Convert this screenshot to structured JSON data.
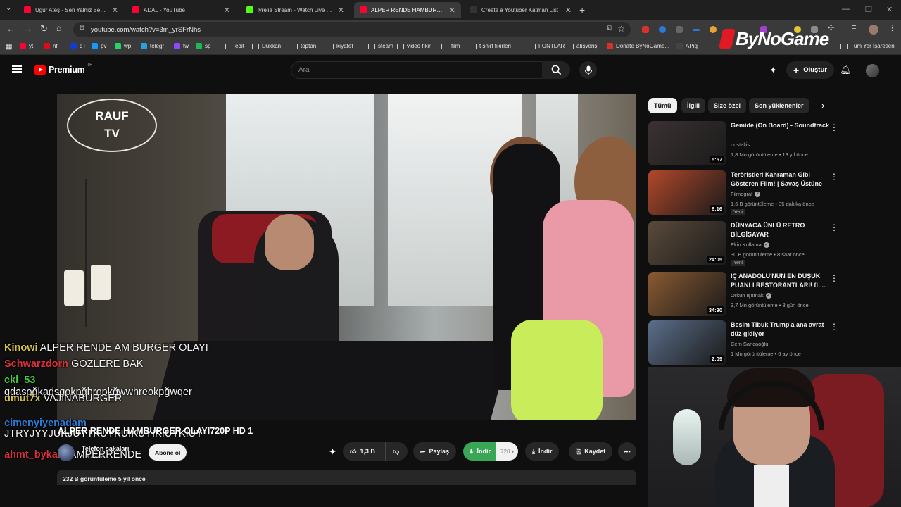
{
  "browser": {
    "tabs": [
      {
        "title": "Uğur Ateş - Sen Yalnız Ben Yalnız",
        "fav": "#ff0033",
        "active": false
      },
      {
        "title": "ADAL - YouTube",
        "fav": "#ff0033",
        "active": false
      },
      {
        "title": "lyrelia Stream - Watch Live on Kick",
        "fav": "#53fc18",
        "active": false
      },
      {
        "title": "ALPER RENDE HAMBURGER OLAYI",
        "fav": "#ff0033",
        "active": true
      },
      {
        "title": "Create a Youtuber Katman List",
        "fav": "#333333",
        "active": false
      }
    ],
    "url": "youtube.com/watch?v=3m_yrSFrNhs",
    "bookmarks": [
      {
        "label": "yt",
        "icon": "#ff0033"
      },
      {
        "label": "nf",
        "icon": "#e50914"
      },
      {
        "label": "d+",
        "icon": "#113ccf"
      },
      {
        "label": "pv",
        "icon": "#1399ff"
      },
      {
        "label": "wp",
        "icon": "#25d366"
      },
      {
        "label": "telegr",
        "icon": "#2aa1da"
      },
      {
        "label": "tw",
        "icon": "#9146ff"
      },
      {
        "label": "sp",
        "icon": "#1db954"
      },
      {
        "label": "edit",
        "icon": "folder"
      },
      {
        "label": "Dükkan",
        "icon": "folder"
      },
      {
        "label": "toptan",
        "icon": "folder"
      },
      {
        "label": "kıyafet",
        "icon": "folder"
      },
      {
        "label": "steam",
        "icon": "folder"
      },
      {
        "label": "video fikir",
        "icon": "folder"
      },
      {
        "label": "film",
        "icon": "folder"
      },
      {
        "label": "t shirt fikirleri",
        "icon": "folder"
      },
      {
        "label": "FONTLAR",
        "icon": "folder"
      },
      {
        "label": "alışveriş",
        "icon": "folder"
      },
      {
        "label": "Donate ByNoGame...",
        "icon": "#d9302c"
      },
      {
        "label": "APiq",
        "icon": "#444444"
      }
    ],
    "all_bookmarks": "Tüm Yer İşaretleri",
    "overlay_logo": "ByNoGame"
  },
  "youtube": {
    "logo_text": "Premium",
    "logo_region": "TR",
    "search_placeholder": "Ara",
    "create_label": "Oluştur"
  },
  "video": {
    "watermark_line1": "RAUF",
    "watermark_line2": "TV",
    "title": "ALPER RENDE HAMBURGER OLAYI720P HD 1",
    "channel": "Telefon sakaları",
    "subs": "3 B abone",
    "subscribe": "Abone ol",
    "likes": "1,3 B",
    "share": "Paylaş",
    "download_ext": "İndir",
    "quality": "720",
    "download": "İndir",
    "save": "Kaydet",
    "views_date": "232 B görüntüleme  5 yıl önce"
  },
  "chat": [
    {
      "user": "Kinowi",
      "color": "#d8c34a",
      "text": "ALPER RENDE AM BURGER OLAYI"
    },
    {
      "user": "Schwarzdorn",
      "color": "#d9313b",
      "text": "GÖZLERE BAK"
    },
    {
      "user": "ckl_53",
      "color": "#3fcf3f",
      "text": "gdasoğkadsgokpğhropkğwwhreokpğwqer"
    },
    {
      "user": "umut7x",
      "color": "#d8c34a",
      "text": "VAJINABURGER"
    },
    {
      "user": "cimenyiyenadam",
      "color": "#2a7bd8",
      "text": "JTRYJYYJUKJUYTKUYKUIKUYIKIUYKIUY"
    },
    {
      "user": "ahmt_bykara",
      "color": "#d9313b",
      "text": "AMPERRENDE"
    }
  ],
  "chips": [
    "Tümü",
    "İlgili",
    "Size özel",
    "Son yüklenenler"
  ],
  "recommendations": [
    {
      "title": "Gemide (On Board) - Soundtrack",
      "channel": "nostaljis",
      "verified": false,
      "meta": "1,8 Mn görüntüleme • 13 yıl önce",
      "duration": "5:57",
      "new": "",
      "thumb": "#3b3232"
    },
    {
      "title": "Teröristleri Kahraman Gibi Gösteren Film! | Savaş Üstüne ...",
      "channel": "Filmograf",
      "verified": true,
      "meta": "1,6 B görüntüleme • 35 dakika önce",
      "duration": "8:16",
      "new": "Yeni",
      "thumb": "#b2482a"
    },
    {
      "title": "DÜNYACA ÜNLÜ RETRO BİLGİSAYAR KOLEKSİYONUNU...",
      "channel": "Ekin Kollama",
      "verified": true,
      "meta": "30 B görüntüleme • 8 saat önce",
      "duration": "24:05",
      "new": "Yeni",
      "thumb": "#5a4a3a"
    },
    {
      "title": "İÇ ANADOLU'NUN EN DÜŞÜK PUANLI RESTORANTLARI! ft. ...",
      "channel": "Orkun Işıtmak",
      "verified": true,
      "meta": "3,7 Mn görüntüleme • 8 gün önce",
      "duration": "34:30",
      "new": "",
      "thumb": "#8a5a32"
    },
    {
      "title": "Besim Tibuk Trump'a ana avrat düz gidiyor",
      "channel": "Cem Sancaoğlu",
      "verified": false,
      "meta": "1 Mn görüntüleme • 6 ay önce",
      "duration": "2:09",
      "new": "",
      "thumb": "#5b6e8a"
    }
  ]
}
